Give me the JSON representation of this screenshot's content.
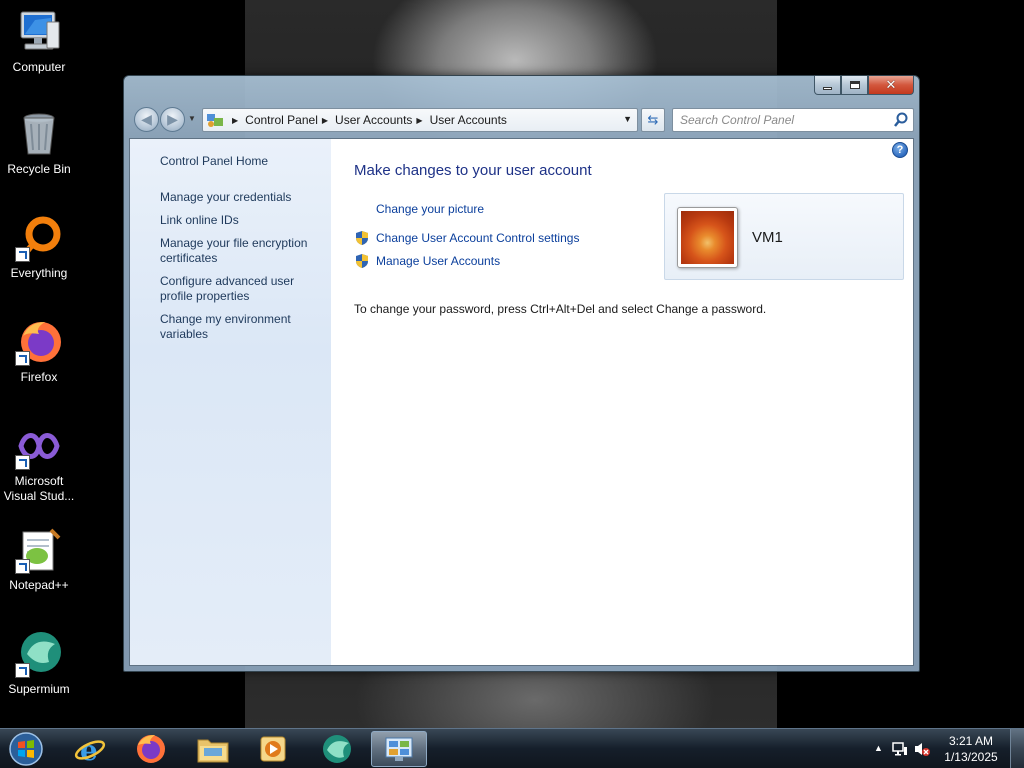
{
  "desktop": {
    "icons": [
      {
        "label": "Computer",
        "icon": "computer-icon"
      },
      {
        "label": "Recycle Bin",
        "icon": "recycle-bin-icon"
      },
      {
        "label": "Everything",
        "icon": "everything-search-icon"
      },
      {
        "label": "Firefox",
        "icon": "firefox-icon"
      },
      {
        "label": "Microsoft Visual Stud...",
        "icon": "visual-studio-icon"
      },
      {
        "label": "Notepad++",
        "icon": "notepad-plus-plus-icon"
      },
      {
        "label": "Supermium",
        "icon": "supermium-icon"
      }
    ]
  },
  "window": {
    "caption_buttons": {
      "minimize": "minimize-icon",
      "maximize": "maximize-icon",
      "close": "close-icon"
    },
    "address_bar": {
      "breadcrumbs": [
        "Control Panel",
        "User Accounts",
        "User Accounts"
      ]
    },
    "search": {
      "placeholder": "Search Control Panel"
    },
    "left_pane": {
      "home": "Control Panel Home",
      "tasks": [
        "Manage your credentials",
        "Link online IDs",
        "Manage your file encryption certificates",
        "Configure advanced user profile properties",
        "Change my environment variables"
      ]
    },
    "main": {
      "title": "Make changes to your user account",
      "links": {
        "change_picture": "Change your picture",
        "uac_settings": "Change User Account Control settings",
        "manage_accounts": "Manage User Accounts"
      },
      "info": "To change your password, press Ctrl+Alt+Del and select Change a password.",
      "account": {
        "name": "VM1"
      },
      "help": "?"
    }
  },
  "taskbar": {
    "apps": [
      "internet-explorer-icon",
      "firefox-icon",
      "file-explorer-icon",
      "media-player-icon",
      "supermium-icon",
      "control-panel-icon"
    ],
    "clock": {
      "time": "3:21 AM",
      "date": "1/13/2025"
    }
  }
}
